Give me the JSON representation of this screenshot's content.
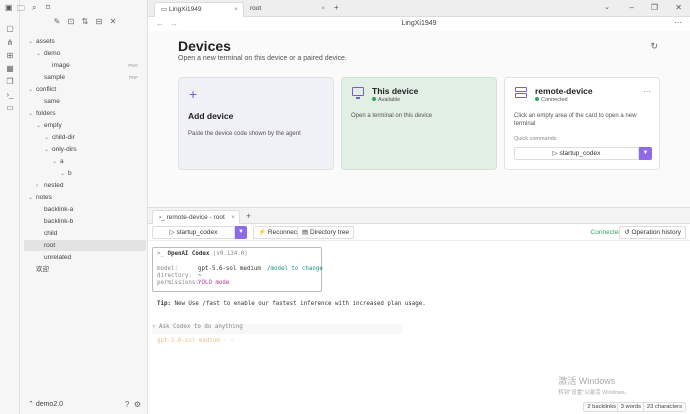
{
  "tabs": [
    {
      "label": "LingXi1949",
      "active": true
    },
    {
      "label": "root",
      "active": false
    }
  ],
  "window_controls": [
    "new-tab",
    "tab-list",
    "minimize",
    "maximize",
    "close"
  ],
  "header": {
    "title": "LingXi1949"
  },
  "sidebar": {
    "tree": [
      {
        "label": "assets",
        "depth": 0,
        "folder": true
      },
      {
        "label": "demo",
        "depth": 1,
        "folder": true
      },
      {
        "label": "image",
        "depth": 2,
        "ext": "PNG"
      },
      {
        "label": "sample",
        "depth": 1,
        "ext": "PDF"
      },
      {
        "label": "conflict",
        "depth": 0,
        "folder": true
      },
      {
        "label": "same",
        "depth": 1
      },
      {
        "label": "folders",
        "depth": 0,
        "folder": true
      },
      {
        "label": "empty",
        "depth": 1,
        "folder": true
      },
      {
        "label": "child-dir",
        "depth": 2,
        "folder": true
      },
      {
        "label": "only-dirs",
        "depth": 2,
        "folder": true
      },
      {
        "label": "a",
        "depth": 3,
        "folder": true
      },
      {
        "label": "b",
        "depth": 4,
        "folder": true
      },
      {
        "label": "nested",
        "depth": 1,
        "folder": true,
        "collapsed": true
      },
      {
        "label": "notes",
        "depth": 0,
        "folder": true
      },
      {
        "label": "backlink-a",
        "depth": 1
      },
      {
        "label": "backlink-b",
        "depth": 1
      },
      {
        "label": "child",
        "depth": 1
      },
      {
        "label": "root",
        "depth": 1,
        "active": true
      },
      {
        "label": "unrelated",
        "depth": 1
      },
      {
        "label": "欢迎",
        "depth": 0
      }
    ],
    "vault_name": "demo2.0"
  },
  "devices": {
    "title": "Devices",
    "subtitle": "Open a new terminal on this device or a paired device.",
    "add": {
      "title": "Add device",
      "desc": "Paste the device code shown by the agent"
    },
    "this_device": {
      "title": "This device",
      "status": "Available",
      "desc": "Open a terminal on this device"
    },
    "remote": {
      "title": "remote-device",
      "status": "Connected",
      "desc": "Click an empty area of the card to open a new terminal",
      "quick_label": "Quick commands",
      "quick_cmd": "startup_codex"
    }
  },
  "terminal": {
    "tab_label": "remote-device - root",
    "command": "startup_codex",
    "reconnect": "Reconnect",
    "directory_tree": "Directory tree",
    "connected": "Connected",
    "operation_history": "Operation history",
    "codex_title": "OpenAI Codex",
    "codex_version": "(v0.134.0)",
    "model_key": "model:",
    "model_val": "gpt-5.6-sol medium",
    "model_hint": "/model to change",
    "dir_key": "directory:",
    "dir_val": "~",
    "perm_key": "permissions:",
    "perm_val": "YOLO mode",
    "tip_label": "Tip:",
    "tip_text": "New Use /fast to enable our fastest inference with increased plan usage.",
    "prompt_placeholder": "Ask Codex to do anything",
    "footer_line": "gpt-5.6-sol medium · ~"
  },
  "watermark": {
    "line1": "激活 Windows",
    "line2": "转到\"设置\"以激活 Windows。"
  },
  "status_bar": {
    "backlinks": "2 backlinks",
    "words": "3 words",
    "characters": "23 characters"
  }
}
